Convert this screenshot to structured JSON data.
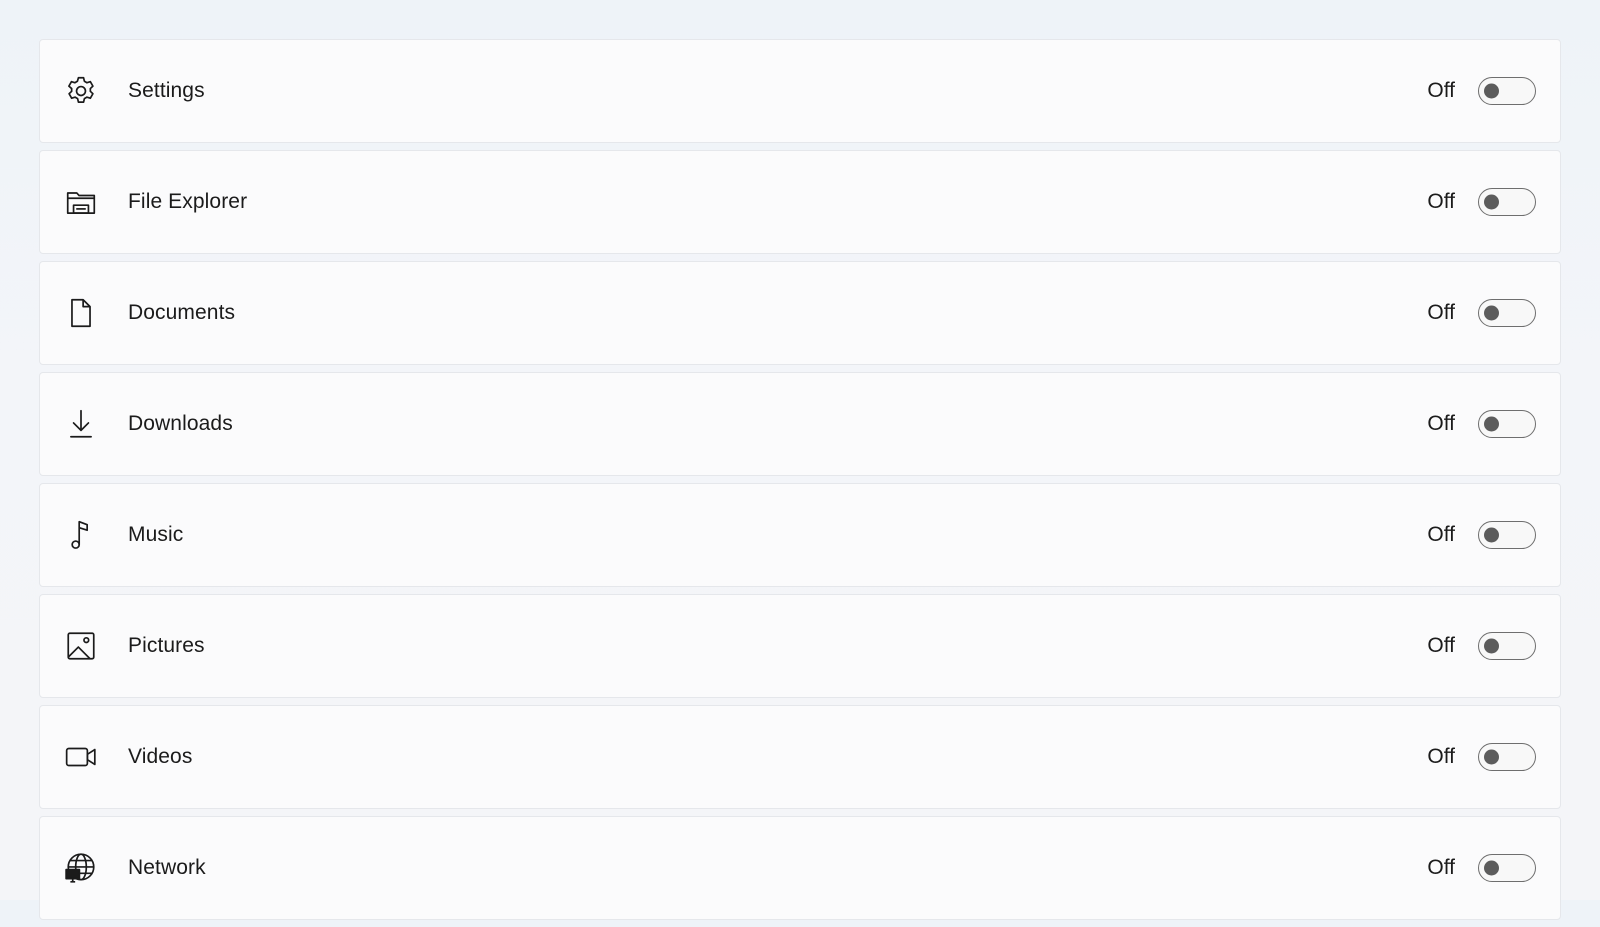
{
  "rows": [
    {
      "name": "settings",
      "icon": "gear-icon",
      "label": "Settings",
      "state": "Off",
      "on": false
    },
    {
      "name": "file-explorer",
      "icon": "folder-icon",
      "label": "File Explorer",
      "state": "Off",
      "on": false
    },
    {
      "name": "documents",
      "icon": "document-icon",
      "label": "Documents",
      "state": "Off",
      "on": false
    },
    {
      "name": "downloads",
      "icon": "download-icon",
      "label": "Downloads",
      "state": "Off",
      "on": false
    },
    {
      "name": "music",
      "icon": "music-note-icon",
      "label": "Music",
      "state": "Off",
      "on": false
    },
    {
      "name": "pictures",
      "icon": "picture-icon",
      "label": "Pictures",
      "state": "Off",
      "on": false
    },
    {
      "name": "videos",
      "icon": "video-camera-icon",
      "label": "Videos",
      "state": "Off",
      "on": false
    },
    {
      "name": "network",
      "icon": "globe-network-icon",
      "label": "Network",
      "state": "Off",
      "on": false
    }
  ]
}
